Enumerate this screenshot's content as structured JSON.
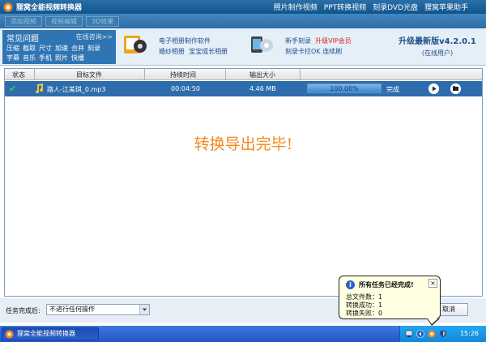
{
  "window": {
    "title": "狸窝全能视频转换器",
    "menus": [
      "照片制作视频",
      "PPT转换视频",
      "刻录DVD光盘",
      "狸窝苹果助手"
    ]
  },
  "toolbar": {
    "buttons": [
      "添加视频",
      "视频编辑",
      "3D效果"
    ]
  },
  "faq": {
    "title": "常见问题",
    "consult": "在线咨询>>",
    "row1": [
      "压缩",
      "截取",
      "尺寸",
      "加速",
      "合并",
      "刻录"
    ],
    "row2": [
      "字幕",
      "音乐",
      "手机",
      "照片",
      "快播"
    ]
  },
  "promo": {
    "line1": "电子相册制作软件",
    "line2a": "婚纱相册",
    "line2b": "宝宝成长相册",
    "line3a": "新手刻录",
    "line3b": "升级VIP会员",
    "line4a": "刻录卡拉OK",
    "line4b": "连续刷"
  },
  "upgrade": {
    "title": "升级最新版v4.2.0.1",
    "subtitle": "(在线用户)"
  },
  "table": {
    "columns": [
      "状态",
      "目标文件",
      "持续时间",
      "输出大小"
    ],
    "rows": [
      {
        "file": "路人-江美琪_0.mp3",
        "duration": "00:04:50",
        "size": "4.46 MB",
        "progress_text": "100.00%",
        "progress": 1.0,
        "status": "完成"
      }
    ]
  },
  "done_message": "转换导出完毕!",
  "bottom": {
    "after_label": "任务完成后:",
    "after_value": "不进行任何操作",
    "cancel": "取消"
  },
  "balloon": {
    "title": "所有任务已经完成!",
    "lines": [
      "总文件数：1",
      "转换成功：1",
      "转换失败：0"
    ]
  },
  "taskbar": {
    "task": "狸窝全能视频转换器",
    "clock": "15:26"
  }
}
